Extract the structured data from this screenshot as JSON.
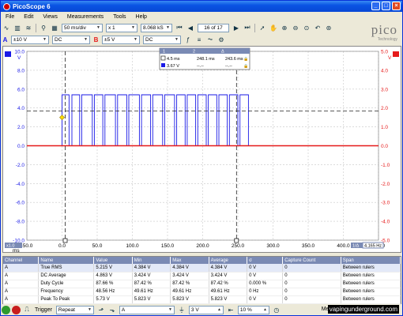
{
  "window": {
    "title": "PicoScope 6",
    "controls": [
      "_",
      "□",
      "×"
    ]
  },
  "menu": [
    "File",
    "Edit",
    "Views",
    "Measurements",
    "Tools",
    "Help"
  ],
  "toolbar": {
    "timebase": "50 ms/div",
    "multiplier": "x 1",
    "sample_info": "8.068 kS",
    "capture_index": "16 of 17"
  },
  "channels": {
    "a": {
      "label": "A",
      "range": "±10 V",
      "coupling": "DC",
      "color": "#1a1ae6"
    },
    "b": {
      "label": "B",
      "range": "±5 V",
      "coupling": "DC",
      "color": "#e61a1a"
    }
  },
  "logo": {
    "text": "pico",
    "sub": "Technology"
  },
  "axes": {
    "left_unit": "V",
    "right_unit": "V",
    "left_ticks": [
      "10.0",
      "8.0",
      "6.0",
      "4.0",
      "2.0",
      "0.0",
      "-2.0",
      "-4.0",
      "-6.0",
      "-8.0",
      "-10.0"
    ],
    "right_ticks": [
      "5.0",
      "4.0",
      "3.0",
      "2.0",
      "1.0",
      "0.0",
      "-1.0",
      "-2.0",
      "-3.0",
      "-4.0",
      "-5.0"
    ],
    "x_ticks": [
      "-50.0",
      "0.0",
      "50.0",
      "100.0",
      "150.0",
      "200.0",
      "250.0",
      "300.0",
      "350.0",
      "400.0",
      "450.0"
    ],
    "x_unit": "ms",
    "x_scale_left": "x1.0",
    "x_scale_right": "4.165 Hz",
    "x_scale_marker": "1/Δ"
  },
  "ruler_panel": {
    "headers": [
      "1",
      "2",
      "Δ"
    ],
    "row_time": [
      "4.5 ms",
      "248.1 ms",
      "243.6 ms"
    ],
    "row_volt": [
      "3.67 V",
      "--.--",
      "--.--"
    ]
  },
  "chart_data": {
    "type": "line",
    "x_unit": "ms",
    "xlim": [
      -50,
      450
    ],
    "series": [
      {
        "name": "A",
        "color": "#1a1ae6",
        "axis": "left",
        "ylim": [
          -10,
          10
        ],
        "x": [
          -50,
          0,
          0,
          10,
          10,
          14,
          14,
          25,
          25,
          28,
          28,
          43,
          43,
          46,
          46,
          58,
          58,
          61,
          61,
          76,
          76,
          79,
          79,
          92,
          92,
          95,
          95,
          110,
          110,
          113,
          113,
          126,
          126,
          129,
          129,
          143,
          143,
          146,
          146,
          160,
          160,
          163,
          163,
          175,
          175,
          178,
          178,
          190,
          190,
          193,
          193,
          205,
          205,
          208,
          208,
          220,
          220,
          223,
          223,
          235,
          235,
          238,
          238,
          250,
          250,
          253,
          253,
          265,
          265,
          450
        ],
        "y": [
          0,
          0,
          5.4,
          5.4,
          0,
          0,
          5.4,
          5.4,
          0,
          0,
          5.4,
          5.4,
          0,
          0,
          5.4,
          5.4,
          0,
          0,
          5.4,
          5.4,
          0,
          0,
          5.4,
          5.4,
          0,
          0,
          5.4,
          5.4,
          0,
          0,
          5.4,
          5.4,
          0,
          0,
          5.4,
          5.4,
          0,
          0,
          5.4,
          5.4,
          0,
          0,
          5.4,
          5.4,
          0,
          0,
          5.4,
          5.4,
          0,
          0,
          5.4,
          5.4,
          0,
          0,
          5.4,
          5.4,
          0,
          0,
          5.4,
          5.4,
          0,
          0,
          5.4,
          5.4,
          0,
          0,
          5.4,
          5.4,
          0,
          0
        ]
      },
      {
        "name": "B",
        "color": "#e61a1a",
        "axis": "right",
        "ylim": [
          -5,
          5
        ],
        "x": [
          -50,
          450
        ],
        "y": [
          0,
          0
        ]
      }
    ],
    "rulers": {
      "x1": 4.5,
      "x2": 248.1,
      "y_level": 3.67
    }
  },
  "measurements": {
    "columns": [
      "Channel",
      "Name",
      "Value",
      "Min",
      "Max",
      "Average",
      "σ",
      "Capture Count",
      "Span"
    ],
    "rows": [
      [
        "A",
        "True RMS",
        "5.215 V",
        "4.384 V",
        "4.384 V",
        "4.384 V",
        "0 V",
        "0",
        "Between rulers"
      ],
      [
        "A",
        "DC Average",
        "4.863 V",
        "3.424 V",
        "3.424 V",
        "3.424 V",
        "0 V",
        "0",
        "Between rulers"
      ],
      [
        "A",
        "Duty Cycle",
        "87.66 %",
        "87.42 %",
        "87.42 %",
        "87.42 %",
        "0.000 %",
        "0",
        "Between rulers"
      ],
      [
        "A",
        "Frequency",
        "48.56 Hz",
        "49.61 Hz",
        "49.61 Hz",
        "49.61 Hz",
        "0 Hz",
        "0",
        "Between rulers"
      ],
      [
        "A",
        "Peak To Peak",
        "5.73 V",
        "5.823 V",
        "5.823 V",
        "5.823 V",
        "0 V",
        "0",
        "Between rulers"
      ]
    ]
  },
  "statusbar": {
    "trigger_label": "Trigger",
    "trigger_mode": "Repeat",
    "trigger_source": "A",
    "trigger_level": "3 V",
    "pre_trigger": "10 %",
    "measurements_label": "Measurements",
    "watermark": "vapingunderground.com"
  }
}
